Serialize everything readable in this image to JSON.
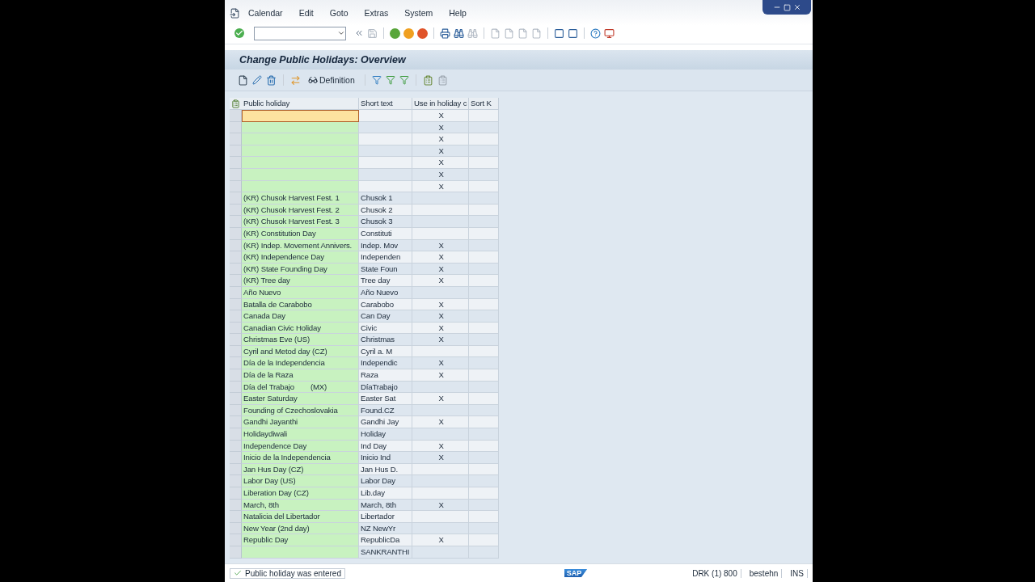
{
  "menu": [
    "Calendar",
    "Edit",
    "Goto",
    "Extras",
    "System",
    "Help"
  ],
  "title": "Change Public Holidays: Overview",
  "app_toolbar": {
    "definition_button": "Definition"
  },
  "table": {
    "columns": [
      "Public holiday",
      "Short text",
      "Use in holiday c",
      "Sort K"
    ],
    "rows": [
      {
        "focused": true,
        "use": "X"
      },
      {
        "focused": false,
        "use": "X"
      },
      {
        "focused": false,
        "use": "X"
      },
      {
        "focused": false,
        "use": "X"
      },
      {
        "focused": false,
        "use": "X"
      },
      {
        "focused": false,
        "use": "X"
      },
      {
        "focused": false,
        "use": "X"
      },
      {
        "focused": false,
        "holiday": "(KR) Chusok Harvest Fest. 1",
        "short": "Chusok 1"
      },
      {
        "focused": false,
        "holiday": "(KR) Chusok Harvest Fest. 2",
        "short": "Chusok 2"
      },
      {
        "focused": false,
        "holiday": "(KR) Chusok Harvest Fest. 3",
        "short": "Chusok 3"
      },
      {
        "focused": false,
        "holiday": "(KR) Constitution Day",
        "short": "Constituti"
      },
      {
        "focused": false,
        "holiday": "(KR) Indep. Movement Annivers.",
        "short": "Indep. Mov",
        "use": "X"
      },
      {
        "focused": false,
        "holiday": "(KR) Independence Day",
        "short": "Independen",
        "use": "X"
      },
      {
        "focused": false,
        "holiday": "(KR) State Founding Day",
        "short": "State Foun",
        "use": "X"
      },
      {
        "focused": false,
        "holiday": "(KR) Tree day",
        "short": "Tree day",
        "use": "X"
      },
      {
        "focused": false,
        "holiday": "Año Nuevo",
        "short": "Año Nuevo"
      },
      {
        "focused": false,
        "holiday": "Batalla de Carabobo",
        "short": "Carabobo",
        "use": "X"
      },
      {
        "focused": false,
        "holiday": "Canada Day",
        "short": "Can Day",
        "use": "X"
      },
      {
        "focused": false,
        "holiday": "Canadian Civic Holiday",
        "short": "Civic",
        "use": "X"
      },
      {
        "focused": false,
        "holiday": "Christmas Eve (US)",
        "short": "Christmas",
        "use": "X"
      },
      {
        "focused": false,
        "holiday": "Cyril and Metod day (CZ)",
        "short": "Cyril a. M"
      },
      {
        "focused": false,
        "holiday": "Día de la Independencia",
        "short": "Independic",
        "use": "X"
      },
      {
        "focused": false,
        "holiday": "Día de la Raza",
        "short": "Raza",
        "use": "X"
      },
      {
        "focused": false,
        "holiday": "Día del Trabajo        (MX)",
        "short": "DíaTrabajo"
      },
      {
        "focused": false,
        "holiday": "Easter Saturday",
        "short": "Easter Sat",
        "use": "X"
      },
      {
        "focused": false,
        "holiday": "Founding of Czechoslovakia",
        "short": "Found.CZ"
      },
      {
        "focused": false,
        "holiday": "Gandhi Jayanthi",
        "short": "Gandhi Jay",
        "use": "X"
      },
      {
        "focused": false,
        "holiday": "Holidaydiwali",
        "short": "Holiday"
      },
      {
        "focused": false,
        "holiday": "Independence Day",
        "short": "Ind Day",
        "use": "X"
      },
      {
        "focused": false,
        "holiday": "Inicio de la Independencia",
        "short": "Inicio Ind",
        "use": "X"
      },
      {
        "focused": false,
        "holiday": "Jan Hus Day (CZ)",
        "short": "Jan Hus D."
      },
      {
        "focused": false,
        "holiday": "Labor Day (US)",
        "short": "Labor Day"
      },
      {
        "focused": false,
        "holiday": "Liberation Day (CZ)",
        "short": "Lib.day"
      },
      {
        "focused": false,
        "holiday": "March, 8th",
        "short": "March, 8th",
        "use": "X"
      },
      {
        "focused": false,
        "holiday": "Natalicia del Libertador",
        "short": "Libertador"
      },
      {
        "focused": false,
        "holiday": "New Year (2nd day)",
        "short": "NZ NewYr"
      },
      {
        "focused": false,
        "holiday": "Republic Day",
        "short": "RepublicDa",
        "use": "X"
      },
      {
        "focused": false,
        "short": "SANKRANTHI"
      }
    ]
  },
  "status_bar": {
    "message": "Public holiday was entered",
    "sap_logo": "SAP",
    "system": "DRK (1) 800",
    "user": "bestehn",
    "mode": "INS"
  }
}
